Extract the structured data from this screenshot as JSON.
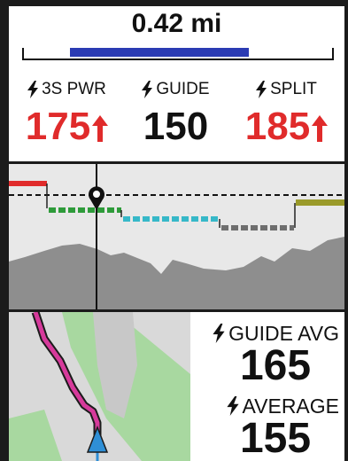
{
  "distance": {
    "value": "0.42 mi",
    "progress_fraction": 0.73,
    "progress_start_fraction": 0.15,
    "bar_color": "#2b3bb3"
  },
  "fields": [
    {
      "label": "3S PWR",
      "value": "175",
      "trend": "up",
      "value_color": "#e02b2b"
    },
    {
      "label": "GUIDE",
      "value": "150",
      "trend": "none",
      "value_color": "#111111"
    },
    {
      "label": "SPLIT",
      "value": "185",
      "trend": "up",
      "value_color": "#e02b2b"
    }
  ],
  "graph": {
    "marker_icon": "location-pin-icon",
    "target_segment_colors": [
      "#e02b2b",
      "#2e9b3a",
      "#36b8c8",
      "#6e6e6e",
      "#9a9a2a"
    ]
  },
  "map": {
    "route_color": "#d63a9b",
    "position_icon": "navigation-arrow-icon",
    "position_color": "#2f8fd6"
  },
  "bottom_fields": [
    {
      "label": "GUIDE AVG",
      "value": "165"
    },
    {
      "label": "AVERAGE",
      "value": "155"
    }
  ]
}
